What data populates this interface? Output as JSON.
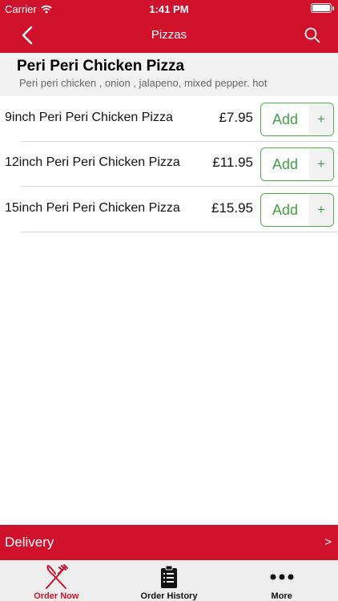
{
  "status_bar": {
    "carrier": "Carrier",
    "time": "1:41 PM",
    "battery_level": 1.0
  },
  "nav": {
    "title": "Pizzas",
    "back_icon": "chevron-left-icon",
    "search_icon": "search-icon"
  },
  "product": {
    "name": "Peri Peri Chicken Pizza",
    "description": "Peri peri chicken , onion , jalapeno, mixed pepper. hot"
  },
  "options": [
    {
      "label": "9inch Peri Peri Chicken Pizza",
      "price": "£7.95",
      "add_label": "Add",
      "plus": "+"
    },
    {
      "label": "12inch Peri Peri Chicken Pizza",
      "price": "£11.95",
      "add_label": "Add",
      "plus": "+"
    },
    {
      "label": "15inch Peri Peri Chicken Pizza",
      "price": "£15.95",
      "add_label": "Add",
      "plus": "+"
    }
  ],
  "delivery": {
    "label": "Delivery",
    "arrow": ">"
  },
  "tabs": [
    {
      "label": "Order Now",
      "icon": "fork-knife-icon",
      "active": true
    },
    {
      "label": "Order History",
      "icon": "clipboard-list-icon",
      "active": false
    },
    {
      "label": "More",
      "icon": "more-dots-icon",
      "active": false
    }
  ],
  "colors": {
    "brand_red": "#d0112b",
    "add_green": "#43a047",
    "header_gray": "#f2f2f2"
  }
}
